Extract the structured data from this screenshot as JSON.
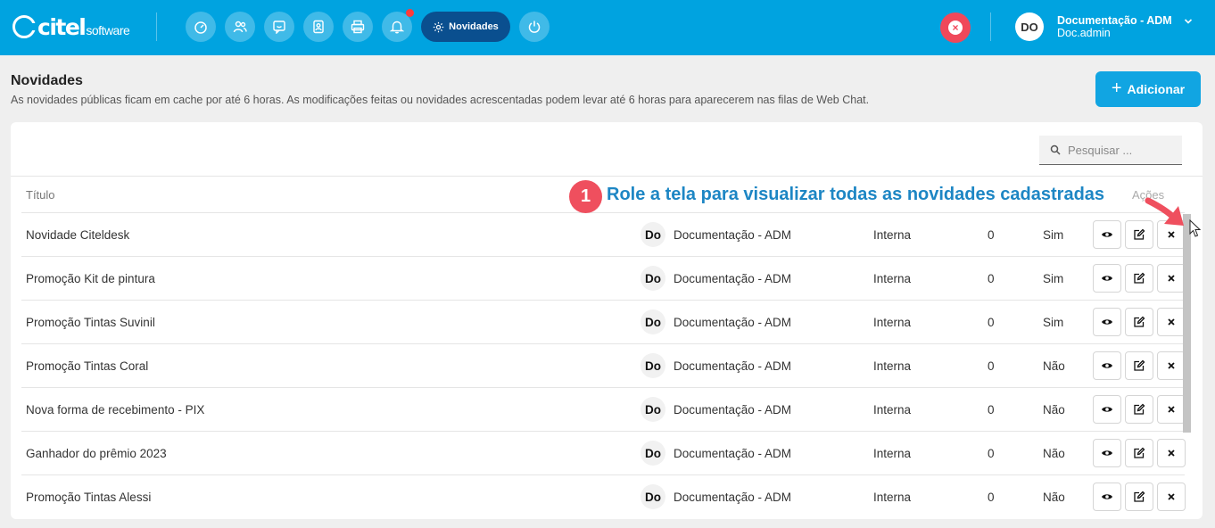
{
  "topbar": {
    "logo_text": "citel",
    "logo_sub": "software",
    "nav_icons": [
      "dashboard-icon",
      "users-icon",
      "chat-icon",
      "contacts-icon",
      "printer-icon",
      "bell-icon"
    ],
    "active_nav_label": "Novidades",
    "power_icon": "power-icon",
    "brand_color": "#00a3e0",
    "active_color": "#0a4f8f",
    "alert_color": "#f0485a"
  },
  "user": {
    "initials": "DO",
    "name": "Documentação - ADM",
    "login": "Doc.admin"
  },
  "page": {
    "title": "Novidades",
    "description": "As novidades públicas ficam em cache por até 6 horas. As modificações feitas ou novidades acrescentadas podem levar até 6 horas para aparecerem nas filas de Web Chat.",
    "add_button_label": "Adicionar"
  },
  "search": {
    "placeholder": "Pesquisar ..."
  },
  "table": {
    "header_title": "Título",
    "header_actions": "Ações",
    "rows": [
      {
        "title": "Novidade Citeldesk",
        "badge": "Do",
        "author": "Documentação - ADM",
        "type": "Interna",
        "count": "0",
        "public": "Sim"
      },
      {
        "title": "Promoção Kit de pintura",
        "badge": "Do",
        "author": "Documentação - ADM",
        "type": "Interna",
        "count": "0",
        "public": "Sim"
      },
      {
        "title": "Promoção Tintas Suvinil",
        "badge": "Do",
        "author": "Documentação - ADM",
        "type": "Interna",
        "count": "0",
        "public": "Sim"
      },
      {
        "title": "Promoção Tintas Coral",
        "badge": "Do",
        "author": "Documentação - ADM",
        "type": "Interna",
        "count": "0",
        "public": "Não"
      },
      {
        "title": "Nova forma de recebimento - PIX",
        "badge": "Do",
        "author": "Documentação - ADM",
        "type": "Interna",
        "count": "0",
        "public": "Não"
      },
      {
        "title": "Ganhador do prêmio 2023",
        "badge": "Do",
        "author": "Documentação - ADM",
        "type": "Interna",
        "count": "0",
        "public": "Não"
      },
      {
        "title": "Promoção Tintas Alessi",
        "badge": "Do",
        "author": "Documentação - ADM",
        "type": "Interna",
        "count": "0",
        "public": "Não"
      }
    ]
  },
  "annotation": {
    "number": "1",
    "text": "Role a tela para visualizar todas as novidades cadastradas"
  }
}
